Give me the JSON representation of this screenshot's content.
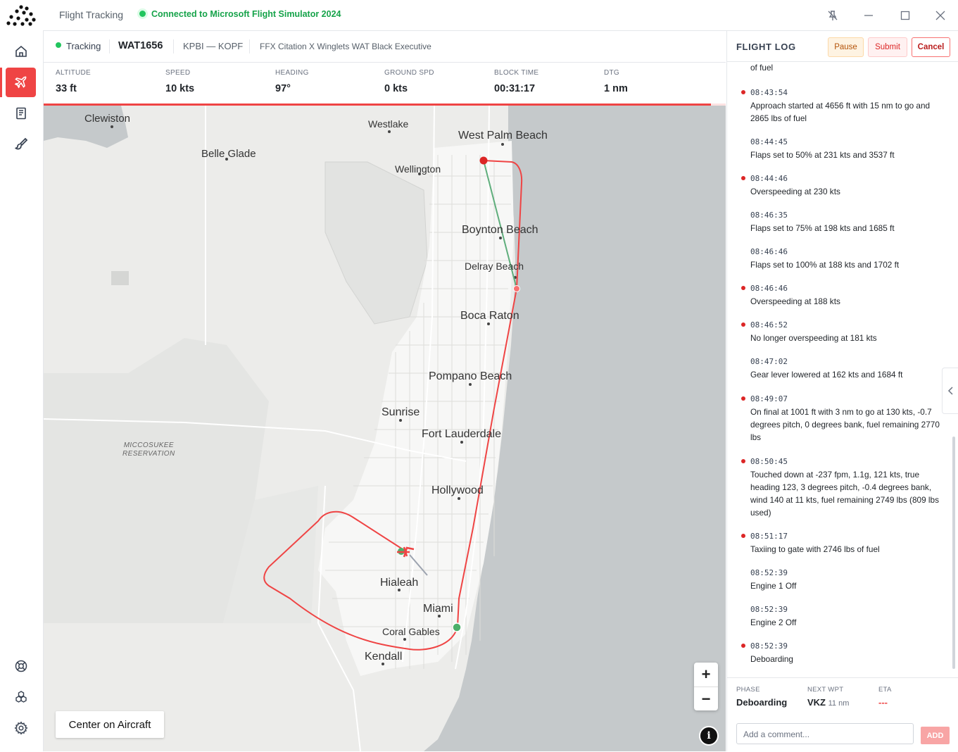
{
  "window": {
    "title": "Flight Tracking",
    "connection_status": "Connected to Microsoft Flight Simulator 2024"
  },
  "flight": {
    "status": "Tracking",
    "callsign": "WAT1656",
    "route": "KPBI — KOPF",
    "aircraft": "FFX Citation X Winglets WAT Black Executive"
  },
  "stats": [
    {
      "label": "ALTITUDE",
      "value": "33 ft"
    },
    {
      "label": "SPEED",
      "value": "10 kts"
    },
    {
      "label": "HEADING",
      "value": "97°"
    },
    {
      "label": "GROUND SPD",
      "value": "0 kts"
    },
    {
      "label": "BLOCK TIME",
      "value": "00:31:17"
    },
    {
      "label": "DTG",
      "value": "1 nm"
    }
  ],
  "map": {
    "cities": [
      "Clewiston",
      "Belle Glade",
      "Westlake",
      "West Palm Beach",
      "Wellington",
      "Boynton Beach",
      "Delray Beach",
      "Boca Raton",
      "Pompano Beach",
      "Sunrise",
      "Fort Lauderdale",
      "Hollywood",
      "Hialeah",
      "Miami",
      "Coral Gables",
      "Kendall"
    ],
    "reservation_line1": "MICCOSUKEE",
    "reservation_line2": "RESERVATION",
    "center_button": "Center on Aircraft",
    "zoom_in": "+",
    "zoom_out": "−",
    "info": "i",
    "route_color": "#ef4444",
    "plan_color": "#5fae7c"
  },
  "log": {
    "title": "FLIGHT LOG",
    "pause": "Pause",
    "submit": "Submit",
    "cancel": "Cancel",
    "entries": [
      {
        "time": "",
        "text": "of fuel",
        "alert": false
      },
      {
        "time": "08:43:54",
        "text": "Approach started at 4656 ft with 15 nm to go and 2865 lbs of fuel",
        "alert": true
      },
      {
        "time": "08:44:45",
        "text": "Flaps set to 50% at 231 kts and 3537 ft",
        "alert": false
      },
      {
        "time": "08:44:46",
        "text": "Overspeeding at 230 kts",
        "alert": true
      },
      {
        "time": "08:46:35",
        "text": "Flaps set to 75% at 198 kts and 1685 ft",
        "alert": false
      },
      {
        "time": "08:46:46",
        "text": "Flaps set to 100% at 188 kts and 1702 ft",
        "alert": false
      },
      {
        "time": "08:46:46",
        "text": "Overspeeding at 188 kts",
        "alert": true
      },
      {
        "time": "08:46:52",
        "text": "No longer overspeeding at 181 kts",
        "alert": true
      },
      {
        "time": "08:47:02",
        "text": "Gear lever lowered at 162 kts and 1684 ft",
        "alert": false
      },
      {
        "time": "08:49:07",
        "text": "On final at 1001 ft with 3 nm to go at 130 kts, -0.7 degrees pitch, 0 degrees bank, fuel remaining 2770 lbs",
        "alert": true
      },
      {
        "time": "08:50:45",
        "text": "Touched down at -237 fpm, 1.1g, 121 kts, true heading 123, 3 degrees pitch, -0.4 degrees bank, wind 140 at 11 kts, fuel remaining 2749 lbs (809 lbs used)",
        "alert": true
      },
      {
        "time": "08:51:17",
        "text": "Taxiing to gate with 2746 lbs of fuel",
        "alert": true
      },
      {
        "time": "08:52:39",
        "text": "Engine 1 Off",
        "alert": false
      },
      {
        "time": "08:52:39",
        "text": "Engine 2 Off",
        "alert": false
      },
      {
        "time": "08:52:39",
        "text": "Deboarding",
        "alert": true
      }
    ]
  },
  "footer": {
    "phase_label": "PHASE",
    "phase": "Deboarding",
    "next_wpt_label": "NEXT WPT",
    "next_wpt": "VKZ",
    "next_wpt_dist": "11 nm",
    "eta_label": "ETA",
    "eta": "---",
    "comment_placeholder": "Add a comment...",
    "add": "ADD"
  }
}
